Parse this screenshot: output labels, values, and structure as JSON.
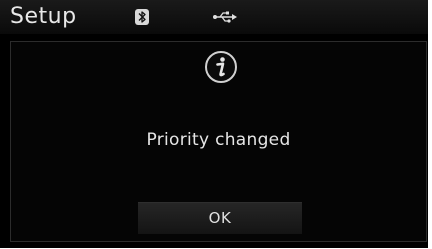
{
  "statusbar": {
    "title": "Setup",
    "icons": [
      "bluetooth-icon",
      "usb-icon"
    ]
  },
  "dialog": {
    "icon": "info-icon",
    "message": "Priority changed",
    "ok_label": "OK"
  },
  "colors": {
    "background": "#000000",
    "text": "#e6e6e6",
    "button": "#1e1e1e"
  }
}
